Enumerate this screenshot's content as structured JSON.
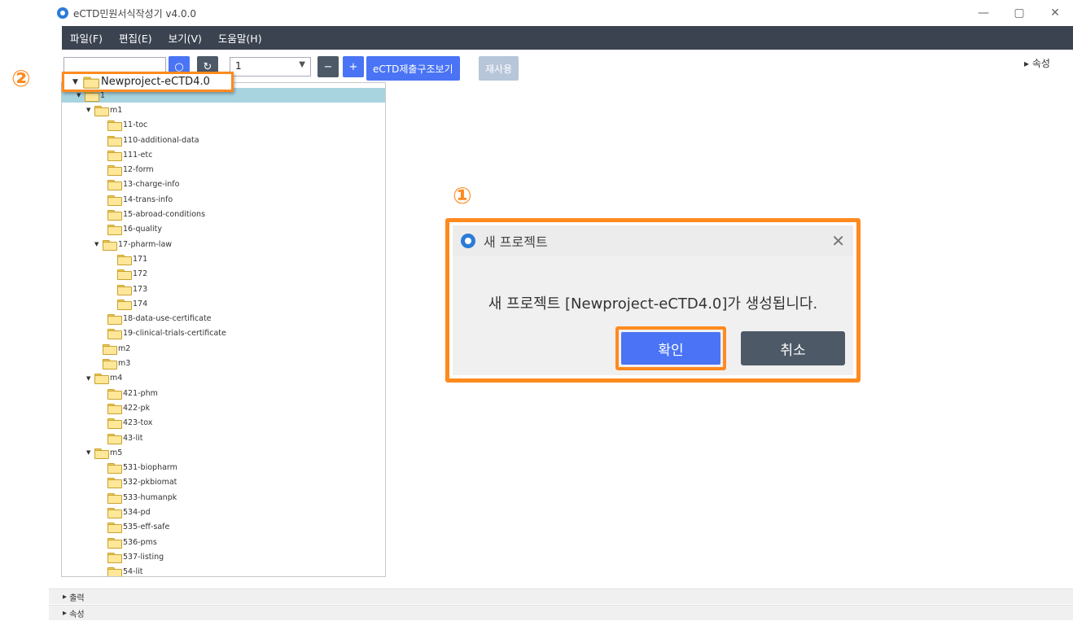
{
  "window": {
    "title": "eCTD민원서식작성기 v4.0.0"
  },
  "menu": [
    "파일(F)",
    "편집(E)",
    "보기(V)",
    "도움말(H)"
  ],
  "toolbar": {
    "select_value": "1",
    "minus_label": "−",
    "plus_label": "+",
    "view_structure_label": "eCTD제출구조보기",
    "reuse_label": "재사용",
    "props_toggle_label": "▸ 속성"
  },
  "root_node": "Newproject-eCTD4.0",
  "tree": [
    {
      "label": "1",
      "arrow": "▼"
    },
    {
      "label": "m1",
      "arrow": "▼"
    },
    {
      "label": "11-toc"
    },
    {
      "label": "110-additional-data"
    },
    {
      "label": "111-etc"
    },
    {
      "label": "12-form"
    },
    {
      "label": "13-charge-info"
    },
    {
      "label": "14-trans-info"
    },
    {
      "label": "15-abroad-conditions"
    },
    {
      "label": "16-quality"
    },
    {
      "label": "17-pharm-law",
      "arrow": "▼"
    },
    {
      "label": "171"
    },
    {
      "label": "172"
    },
    {
      "label": "173"
    },
    {
      "label": "174"
    },
    {
      "label": "18-data-use-certificate"
    },
    {
      "label": "19-clinical-trials-certificate"
    },
    {
      "label": "m2"
    },
    {
      "label": "m3"
    },
    {
      "label": "m4",
      "arrow": "▼"
    },
    {
      "label": "421-phm"
    },
    {
      "label": "422-pk"
    },
    {
      "label": "423-tox"
    },
    {
      "label": "43-lit"
    },
    {
      "label": "m5",
      "arrow": "▼"
    },
    {
      "label": "531-biopharm"
    },
    {
      "label": "532-pkbiomat"
    },
    {
      "label": "533-humanpk"
    },
    {
      "label": "534-pd"
    },
    {
      "label": "535-eff-safe"
    },
    {
      "label": "536-pms"
    },
    {
      "label": "537-listing"
    },
    {
      "label": "54-lit"
    }
  ],
  "bottom": {
    "output_label": "출력",
    "props_label": "속성"
  },
  "markers": {
    "one": "①",
    "two": "②"
  },
  "dialog": {
    "title": "새 프로젝트",
    "message": "새 프로젝트 [Newproject-eCTD4.0]가 생성됩니다.",
    "ok_label": "확인",
    "cancel_label": "취소",
    "close_glyph": "✕"
  },
  "colors": {
    "accent": "#ff8a1e",
    "primary": "#4a74f5",
    "menubar": "#3b4350",
    "selection": "#a8d4e0"
  }
}
